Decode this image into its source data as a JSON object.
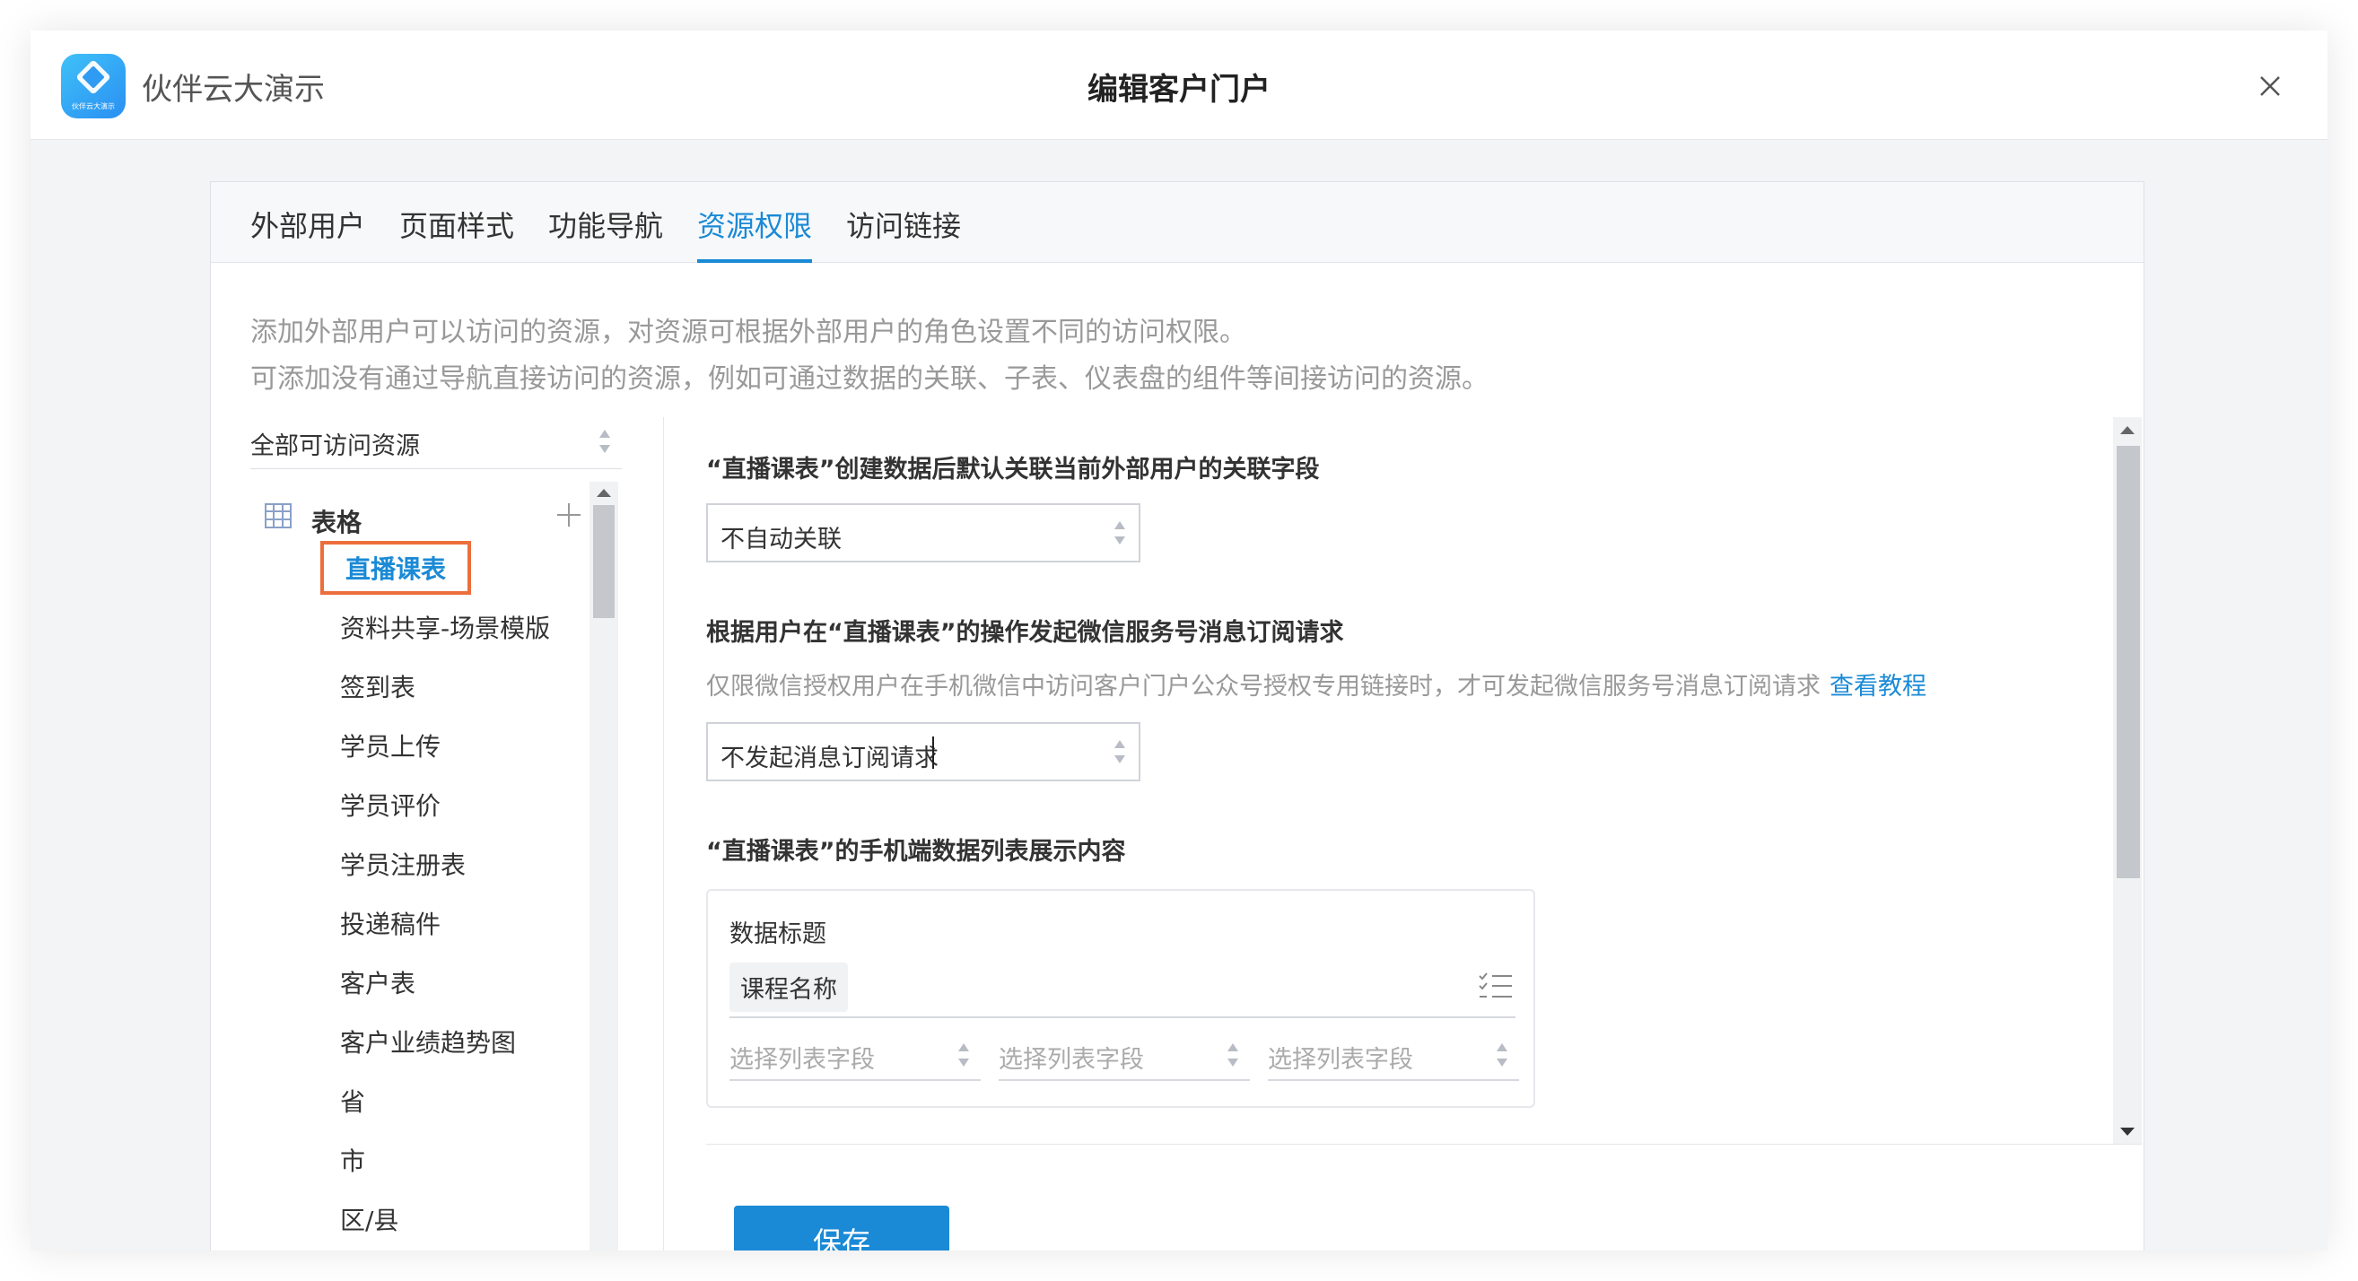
{
  "app": {
    "name": "伙伴云大演示",
    "logo_text": "伙伴云大演示"
  },
  "dialog": {
    "title": "编辑客户门户"
  },
  "tabs": [
    {
      "label": "外部用户"
    },
    {
      "label": "页面样式"
    },
    {
      "label": "功能导航"
    },
    {
      "label": "资源权限",
      "active": true
    },
    {
      "label": "访问链接"
    }
  ],
  "description": {
    "line1": "添加外部用户可以访问的资源，对资源可根据外部用户的角色设置不同的访问权限。",
    "line2": "可添加没有通过导航直接访问的资源，例如可通过数据的关联、子表、仪表盘的组件等间接访问的资源。"
  },
  "resource_filter": {
    "value": "全部可访问资源"
  },
  "resource_group": {
    "label": "表格",
    "icon": "table-icon"
  },
  "resources": [
    {
      "label": "直播课表",
      "selected": true
    },
    {
      "label": "资料共享-场景模版"
    },
    {
      "label": "签到表"
    },
    {
      "label": "学员上传"
    },
    {
      "label": "学员评价"
    },
    {
      "label": "学员注册表"
    },
    {
      "label": "投递稿件"
    },
    {
      "label": "客户表"
    },
    {
      "label": "客户业绩趋势图"
    },
    {
      "label": "省"
    },
    {
      "label": "市"
    },
    {
      "label": "区/县"
    }
  ],
  "settings": {
    "auto_link": {
      "title": "“直播课表”创建数据后默认关联当前外部用户的关联字段",
      "value": "不自动关联"
    },
    "subscription": {
      "title": "根据用户在“直播课表”的操作发起微信服务号消息订阅请求",
      "hint": "仅限微信授权用户在手机微信中访问客户门户公众号授权专用链接时，才可发起微信服务号消息订阅请求",
      "link": "查看教程",
      "value": "不发起消息订阅请求"
    },
    "mobile_list": {
      "title": "“直播课表”的手机端数据列表展示内容",
      "data_title_label": "数据标题",
      "data_title_tag": "课程名称",
      "field_placeholders": [
        "选择列表字段",
        "选择列表字段",
        "选择列表字段"
      ]
    }
  },
  "buttons": {
    "save": "保存"
  },
  "colors": {
    "accent": "#1a8ad6",
    "highlight": "#ec6e3b"
  }
}
